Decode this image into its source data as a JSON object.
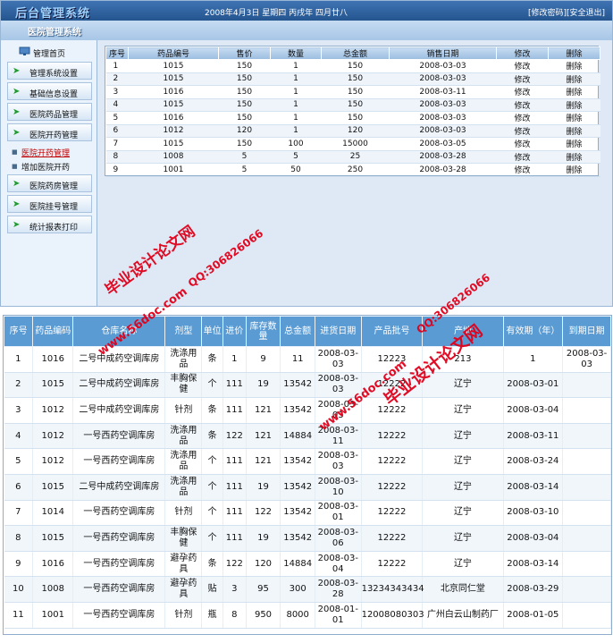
{
  "app": {
    "title": "后台管理系统",
    "subtitle": "医院管理系统",
    "date_line": "2008年4月3日 星期四 丙戌年 四月廿八",
    "change_password": "[修改密码]",
    "logout": "[安全退出]"
  },
  "sidebar": {
    "home": "管理首页",
    "buttons": [
      "管理系统设置",
      "基础信息设置",
      "医院药品管理",
      "医院开药管理"
    ],
    "subitems": [
      "医院开药管理",
      "增加医院开药"
    ],
    "buttons2": [
      "医院药房管理",
      "医院挂号管理",
      "统计报表打印"
    ]
  },
  "top_table": {
    "headers": [
      "序号",
      "药品编号",
      "售价",
      "数量",
      "总金额",
      "销售日期",
      "修改",
      "删除"
    ],
    "rows": [
      [
        "1",
        "1015",
        "150",
        "1",
        "150",
        "2008-03-03",
        "修改",
        "删除"
      ],
      [
        "2",
        "1015",
        "150",
        "1",
        "150",
        "2008-03-03",
        "修改",
        "删除"
      ],
      [
        "3",
        "1016",
        "150",
        "1",
        "150",
        "2008-03-11",
        "修改",
        "删除"
      ],
      [
        "4",
        "1015",
        "150",
        "1",
        "150",
        "2008-03-03",
        "修改",
        "删除"
      ],
      [
        "5",
        "1016",
        "150",
        "1",
        "150",
        "2008-03-03",
        "修改",
        "删除"
      ],
      [
        "6",
        "1012",
        "120",
        "1",
        "120",
        "2008-03-03",
        "修改",
        "删除"
      ],
      [
        "7",
        "1015",
        "150",
        "100",
        "15000",
        "2008-03-05",
        "修改",
        "删除"
      ],
      [
        "8",
        "1008",
        "5",
        "5",
        "25",
        "2008-03-28",
        "修改",
        "删除"
      ],
      [
        "9",
        "1001",
        "5",
        "50",
        "250",
        "2008-03-28",
        "修改",
        "删除"
      ]
    ]
  },
  "bottom_table": {
    "headers": [
      "序号",
      "药品编码",
      "仓库名称",
      "剂型",
      "单位",
      "进价",
      "库存数量",
      "总金额",
      "进货日期",
      "产品批号",
      "产地",
      "有效期（年）",
      "到期日期"
    ],
    "rows": [
      [
        "1",
        "1016",
        "二号中成药空调库房",
        "洗涤用品",
        "条",
        "1",
        "9",
        "11",
        "2008-03-03",
        "12223",
        "",
        "213",
        "1",
        "2008-03-03"
      ],
      [
        "2",
        "1015",
        "二号中成药空调库房",
        "丰胸保健",
        "个",
        "111",
        "19",
        "13542",
        "2008-03-03",
        "12222",
        "辽宁",
        "12",
        "2008-03-01"
      ],
      [
        "3",
        "1012",
        "二号中成药空调库房",
        "针剂",
        "条",
        "111",
        "121",
        "13542",
        "2008-03-03",
        "12222",
        "辽宁",
        "12",
        "2008-03-04"
      ],
      [
        "4",
        "1012",
        "一号西药空调库房",
        "洗涤用品",
        "条",
        "122",
        "121",
        "14884",
        "2008-03-11",
        "12222",
        "辽宁",
        "12",
        "2008-03-11"
      ],
      [
        "5",
        "1012",
        "一号西药空调库房",
        "洗涤用品",
        "个",
        "111",
        "121",
        "13542",
        "2008-03-03",
        "12222",
        "辽宁",
        "12",
        "2008-03-24"
      ],
      [
        "6",
        "1015",
        "二号中成药空调库房",
        "洗涤用品",
        "个",
        "111",
        "19",
        "13542",
        "2008-03-10",
        "12222",
        "辽宁",
        "12",
        "2008-03-14"
      ],
      [
        "7",
        "1014",
        "一号西药空调库房",
        "针剂",
        "个",
        "111",
        "122",
        "13542",
        "2008-03-01",
        "12222",
        "辽宁",
        "12",
        "2008-03-10"
      ],
      [
        "8",
        "1015",
        "一号西药空调库房",
        "丰胸保健",
        "个",
        "111",
        "19",
        "13542",
        "2008-03-06",
        "12222",
        "辽宁",
        "12",
        "2008-03-04"
      ],
      [
        "9",
        "1016",
        "一号西药空调库房",
        "避孕药具",
        "条",
        "122",
        "120",
        "14884",
        "2008-03-04",
        "12222",
        "辽宁",
        "12",
        "2008-03-14"
      ],
      [
        "10",
        "1008",
        "一号西药空调库房",
        "避孕药具",
        "贴",
        "3",
        "95",
        "300",
        "2008-03-28",
        "13234343434",
        "北京同仁堂",
        "5",
        "2008-03-29"
      ],
      [
        "11",
        "1001",
        "一号西药空调库房",
        "针剂",
        "瓶",
        "8",
        "950",
        "8000",
        "2008-01-01",
        "12008080303",
        "广州白云山制药厂",
        "3",
        "2008-01-05"
      ]
    ]
  },
  "watermarks": {
    "site": "www.56doc.com",
    "title": "毕业设计论文网",
    "qq": "QQ:306826066"
  }
}
